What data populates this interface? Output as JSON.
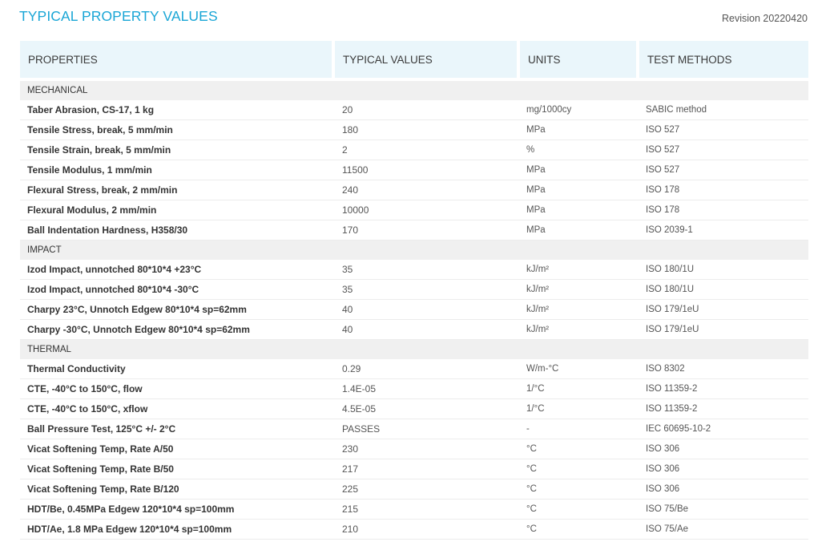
{
  "title": "TYPICAL PROPERTY VALUES",
  "revision": "Revision 20220420",
  "columns": [
    "PROPERTIES",
    "TYPICAL VALUES",
    "UNITS",
    "TEST METHODS"
  ],
  "rows": [
    {
      "type": "section",
      "label": "MECHANICAL"
    },
    {
      "type": "data",
      "property": "Taber Abrasion, CS-17, 1 kg",
      "value": "20",
      "unit": "mg/1000cy",
      "method": "SABIC method"
    },
    {
      "type": "data",
      "property": "Tensile Stress, break, 5 mm/min",
      "value": "180",
      "unit": "MPa",
      "method": "ISO 527"
    },
    {
      "type": "data",
      "property": "Tensile Strain, break, 5 mm/min",
      "value": "2",
      "unit": "%",
      "method": "ISO 527"
    },
    {
      "type": "data",
      "property": "Tensile Modulus, 1 mm/min",
      "value": "11500",
      "unit": "MPa",
      "method": "ISO 527"
    },
    {
      "type": "data",
      "property": "Flexural Stress, break, 2 mm/min",
      "value": "240",
      "unit": "MPa",
      "method": "ISO 178"
    },
    {
      "type": "data",
      "property": "Flexural Modulus, 2 mm/min",
      "value": "10000",
      "unit": "MPa",
      "method": "ISO 178"
    },
    {
      "type": "data",
      "property": "Ball Indentation Hardness, H358/30",
      "value": "170",
      "unit": "MPa",
      "method": "ISO 2039-1"
    },
    {
      "type": "section",
      "label": "IMPACT"
    },
    {
      "type": "data",
      "property": "Izod Impact, unnotched 80*10*4 +23°C",
      "value": "35",
      "unit": "kJ/m²",
      "method": "ISO 180/1U"
    },
    {
      "type": "data",
      "property": "Izod Impact, unnotched 80*10*4 -30°C",
      "value": "35",
      "unit": "kJ/m²",
      "method": "ISO 180/1U"
    },
    {
      "type": "data",
      "property": "Charpy 23°C, Unnotch Edgew 80*10*4 sp=62mm",
      "value": "40",
      "unit": "kJ/m²",
      "method": "ISO 179/1eU"
    },
    {
      "type": "data",
      "property": "Charpy -30°C, Unnotch Edgew 80*10*4 sp=62mm",
      "value": "40",
      "unit": "kJ/m²",
      "method": "ISO 179/1eU"
    },
    {
      "type": "section",
      "label": "THERMAL"
    },
    {
      "type": "data",
      "property": "Thermal Conductivity",
      "value": "0.29",
      "unit": "W/m-°C",
      "method": "ISO 8302"
    },
    {
      "type": "data",
      "property": "CTE, -40°C to 150°C, flow",
      "value": "1.4E-05",
      "unit": "1/°C",
      "method": "ISO 11359-2"
    },
    {
      "type": "data",
      "property": "CTE, -40°C to 150°C, xflow",
      "value": "4.5E-05",
      "unit": "1/°C",
      "method": "ISO 11359-2"
    },
    {
      "type": "data",
      "property": "Ball Pressure Test, 125°C +/- 2°C",
      "value": "PASSES",
      "unit": "-",
      "method": "IEC 60695-10-2"
    },
    {
      "type": "data",
      "property": "Vicat Softening Temp, Rate A/50",
      "value": "230",
      "unit": "°C",
      "method": "ISO 306"
    },
    {
      "type": "data",
      "property": "Vicat Softening Temp, Rate B/50",
      "value": "217",
      "unit": "°C",
      "method": "ISO 306"
    },
    {
      "type": "data",
      "property": "Vicat Softening Temp, Rate B/120",
      "value": "225",
      "unit": "°C",
      "method": "ISO 306"
    },
    {
      "type": "data",
      "property": "HDT/Be, 0.45MPa Edgew 120*10*4 sp=100mm",
      "value": "215",
      "unit": "°C",
      "method": "ISO 75/Be"
    },
    {
      "type": "data",
      "property": "HDT/Ae, 1.8 MPa Edgew 120*10*4 sp=100mm",
      "value": "210",
      "unit": "°C",
      "method": "ISO 75/Ae"
    }
  ]
}
